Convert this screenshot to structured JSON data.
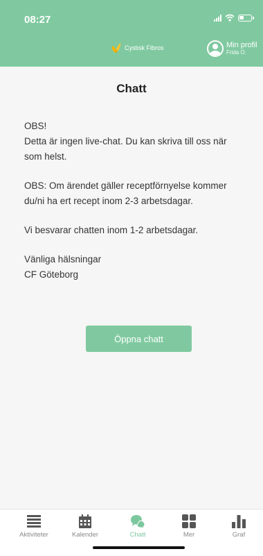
{
  "status_bar": {
    "time": "08:27"
  },
  "header": {
    "brand": "Cystisk Fibros",
    "profile_title": "Min profil",
    "profile_name": "Frida O."
  },
  "page": {
    "title": "Chatt",
    "message": {
      "p1": [
        "OBS!",
        "Detta är ingen live-chat. Du kan skriva till oss när",
        "som helst."
      ],
      "p2": [
        "OBS: Om ärendet gäller receptförnyelse kommer",
        "du/ni ha ert recept inom 2-3 arbetsdagar."
      ],
      "p3": [
        "Vi besvarar chatten inom 1-2 arbetsdagar."
      ],
      "p4": [
        "Vänliga hälsningar",
        "CF Göteborg"
      ]
    },
    "open_button": "Öppna chatt"
  },
  "tabbar": {
    "items": [
      {
        "label": "Aktiviteter",
        "icon": "list-icon"
      },
      {
        "label": "Kalender",
        "icon": "calendar-icon"
      },
      {
        "label": "Chatt",
        "icon": "chat-icon"
      },
      {
        "label": "Mer",
        "icon": "grid-icon"
      },
      {
        "label": "Graf",
        "icon": "bar-chart-icon"
      }
    ],
    "active": "Chatt"
  },
  "colors": {
    "accent": "#80c9a0",
    "active_tab": "#7cc79d",
    "inactive_tab": "#8a8a8a"
  }
}
